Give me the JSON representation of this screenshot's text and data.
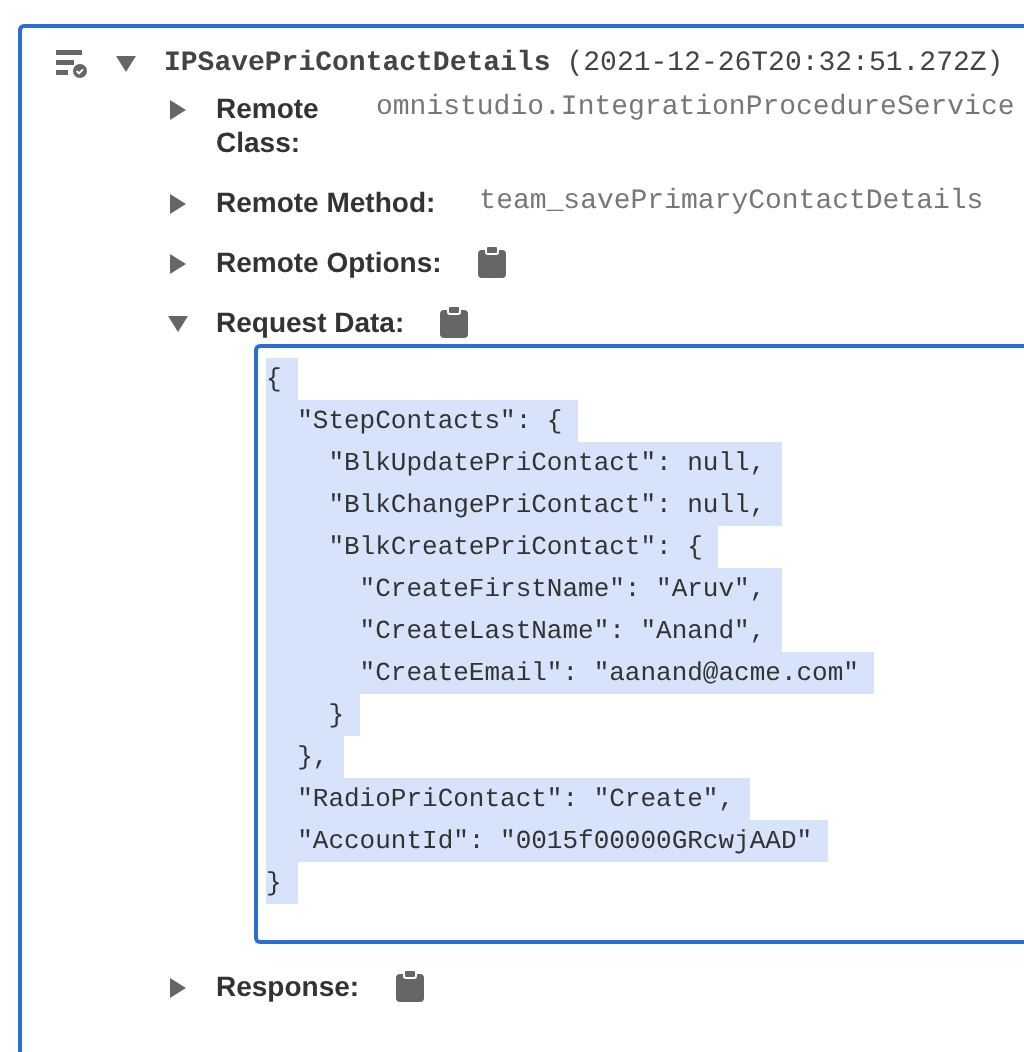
{
  "step": {
    "name": "IPSavePriContactDetails",
    "timestamp": "(2021-12-26T20:32:51.272Z)",
    "expanded": true
  },
  "properties": [
    {
      "label": "Remote Class:",
      "kind": "value",
      "value": "omnistudio.IntegrationProcedureService",
      "expanded": false
    },
    {
      "label": "Remote Method:",
      "kind": "value",
      "value": "team_savePrimaryContactDetails",
      "expanded": false
    },
    {
      "label": "Remote Options:",
      "kind": "clipboard",
      "expanded": false
    },
    {
      "label": "Request Data:",
      "kind": "clipboard",
      "expanded": true,
      "code_lines": [
        "{",
        "  \"StepContacts\": {",
        "    \"BlkUpdatePriContact\": null,",
        "    \"BlkChangePriContact\": null,",
        "    \"BlkCreatePriContact\": {",
        "      \"CreateFirstName\": \"Aruv\",",
        "      \"CreateLastName\": \"Anand\",",
        "      \"CreateEmail\": \"aanand@acme.com\"",
        "    }",
        "  },",
        "  \"RadioPriContact\": \"Create\",",
        "  \"AccountId\": \"0015f00000GRcwjAAD\"",
        "}"
      ]
    },
    {
      "label": "Response:",
      "kind": "clipboard",
      "expanded": false
    }
  ]
}
